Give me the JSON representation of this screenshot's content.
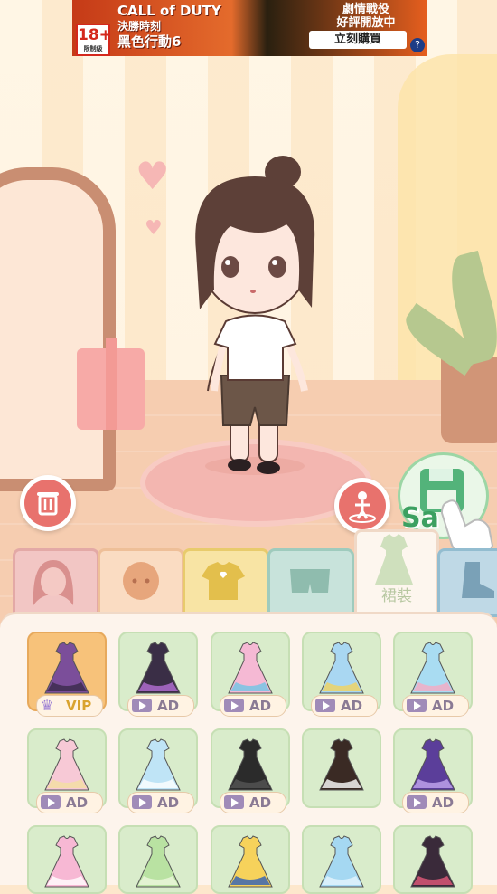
{
  "ad": {
    "age_rating": "18+",
    "age_note": "限制級",
    "brand_line1": "CALL of DUTY",
    "brand_line2": "決勝時刻",
    "brand_line3": "黑色行動6",
    "tagline1": "劇情戰役",
    "tagline2": "好評開放中",
    "buy_label": "立刻購買",
    "help_label": "?"
  },
  "scene": {
    "save_label": "Sa"
  },
  "tabs": [
    {
      "name": "hair",
      "color": "#f2c6c4"
    },
    {
      "name": "face",
      "color": "#fadcc2"
    },
    {
      "name": "tops",
      "color": "#f8e4a4"
    },
    {
      "name": "bottoms",
      "color": "#c8e3db"
    },
    {
      "name": "dresses",
      "label": "裙裝",
      "active": true
    },
    {
      "name": "shoes",
      "color": "#bfd9e6"
    }
  ],
  "items": [
    {
      "badge": "VIP",
      "type": "vip",
      "color": "#7b4e9a",
      "accent": "#3a2a4a"
    },
    {
      "badge": "AD",
      "type": "ad",
      "color": "#3a2e46",
      "accent": "#b56fd6"
    },
    {
      "badge": "AD",
      "type": "ad",
      "color": "#f5b9d4",
      "accent": "#6fc6e5"
    },
    {
      "badge": "AD",
      "type": "ad",
      "color": "#a9d7f2",
      "accent": "#f3d35c"
    },
    {
      "badge": "AD",
      "type": "ad",
      "color": "#a9dcf2",
      "accent": "#f6aac2"
    },
    {
      "badge": "AD",
      "type": "ad",
      "color": "#f7c9d6",
      "accent": "#f3e0a0"
    },
    {
      "badge": "AD",
      "type": "ad",
      "color": "#bfe4f6",
      "accent": "#ffffff"
    },
    {
      "badge": "AD",
      "type": "ad",
      "color": "#2b2b2b",
      "accent": "#555555"
    },
    {
      "badge": "",
      "type": "none",
      "color": "#3a2a24",
      "accent": "#ffffff"
    },
    {
      "badge": "AD",
      "type": "ad",
      "color": "#5b3e9a",
      "accent": "#c3a7ef"
    },
    {
      "badge": "",
      "type": "none",
      "color": "#f7b8d4",
      "accent": "#ffffff"
    },
    {
      "badge": "",
      "type": "none",
      "color": "#b9e2a2",
      "accent": "#eef8df"
    },
    {
      "badge": "",
      "type": "none",
      "color": "#f6d25b",
      "accent": "#2f5fb6"
    },
    {
      "badge": "",
      "type": "none",
      "color": "#a5d8f2",
      "accent": "#e6f5fd"
    },
    {
      "badge": "",
      "type": "none",
      "color": "#3a2a3a",
      "accent": "#e45a7b"
    }
  ]
}
